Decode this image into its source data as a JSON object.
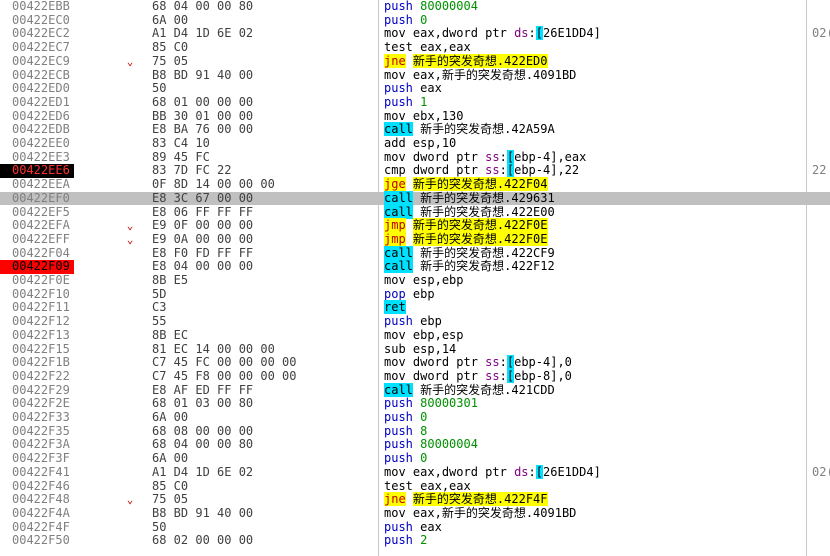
{
  "rows": [
    {
      "addr": "00422EBB",
      "bytes": "68 04 00 00 80",
      "mnem": "push",
      "ops": "80000004"
    },
    {
      "addr": "00422EC0",
      "bytes": "6A 00",
      "mnem": "push",
      "ops": "0"
    },
    {
      "addr": "00422EC2",
      "bytes": "A1 D4 1D 6E 02",
      "mnem": "mov",
      "ops": "eax,dword ptr ds:[26E1DD4]",
      "comment": "02("
    },
    {
      "addr": "00422EC7",
      "bytes": "85 C0",
      "mnem": "test",
      "ops": "eax,eax"
    },
    {
      "addr": "00422EC9",
      "bytes": "75 05",
      "mnem": "jne",
      "ops": "新手的突发奇想.422ED0",
      "arrow": "⌄"
    },
    {
      "addr": "00422ECB",
      "bytes": "B8 BD 91 40 00",
      "mnem": "mov",
      "ops": "eax,新手的突发奇想.4091BD"
    },
    {
      "addr": "00422ED0",
      "bytes": "50",
      "mnem": "push",
      "ops": "eax"
    },
    {
      "addr": "00422ED1",
      "bytes": "68 01 00 00 00",
      "mnem": "push",
      "ops": "1"
    },
    {
      "addr": "00422ED6",
      "bytes": "BB 30 01 00 00",
      "mnem": "mov",
      "ops": "ebx,130"
    },
    {
      "addr": "00422EDB",
      "bytes": "E8 BA 76 00 00",
      "mnem": "call",
      "ops": "新手的突发奇想.42A59A"
    },
    {
      "addr": "00422EE0",
      "bytes": "83 C4 10",
      "mnem": "add",
      "ops": "esp,10"
    },
    {
      "addr": "00422EE3",
      "bytes": "89 45 FC",
      "mnem": "mov",
      "ops": "dword ptr ss:[ebp-4],eax"
    },
    {
      "addr": "00422EE6",
      "bytes": "83 7D FC 22",
      "mnem": "cmp",
      "ops": "dword ptr ss:[ebp-4],22",
      "comment": "22"
    },
    {
      "addr": "00422EEA",
      "bytes": "0F 8D 14 00 00 00",
      "mnem": "jge",
      "ops": "新手的突发奇想.422F04"
    },
    {
      "addr": "00422EF0",
      "bytes": "E8 3C 67 00 00",
      "mnem": "call",
      "ops": "新手的突发奇想.429631"
    },
    {
      "addr": "00422EF5",
      "bytes": "E8 06 FF FF FF",
      "mnem": "call",
      "ops": "新手的突发奇想.422E00"
    },
    {
      "addr": "00422EFA",
      "bytes": "E9 0F 00 00 00",
      "mnem": "jmp",
      "ops": "新手的突发奇想.422F0E",
      "arrow": "⌄"
    },
    {
      "addr": "00422EFF",
      "bytes": "E9 0A 00 00 00",
      "mnem": "jmp",
      "ops": "新手的突发奇想.422F0E",
      "arrow": "⌄"
    },
    {
      "addr": "00422F04",
      "bytes": "E8 F0 FD FF FF",
      "mnem": "call",
      "ops": "新手的突发奇想.422CF9"
    },
    {
      "addr": "00422F09",
      "bytes": "E8 04 00 00 00",
      "mnem": "call",
      "ops": "新手的突发奇想.422F12"
    },
    {
      "addr": "00422F0E",
      "bytes": "8B E5",
      "mnem": "mov",
      "ops": "esp,ebp"
    },
    {
      "addr": "00422F10",
      "bytes": "5D",
      "mnem": "pop",
      "ops": "ebp"
    },
    {
      "addr": "00422F11",
      "bytes": "C3",
      "mnem": "ret",
      "ops": ""
    },
    {
      "addr": "00422F12",
      "bytes": "55",
      "mnem": "push",
      "ops": "ebp"
    },
    {
      "addr": "00422F13",
      "bytes": "8B EC",
      "mnem": "mov",
      "ops": "ebp,esp"
    },
    {
      "addr": "00422F15",
      "bytes": "81 EC 14 00 00 00",
      "mnem": "sub",
      "ops": "esp,14"
    },
    {
      "addr": "00422F1B",
      "bytes": "C7 45 FC 00 00 00 00",
      "mnem": "mov",
      "ops": "dword ptr ss:[ebp-4],0"
    },
    {
      "addr": "00422F22",
      "bytes": "C7 45 F8 00 00 00 00",
      "mnem": "mov",
      "ops": "dword ptr ss:[ebp-8],0"
    },
    {
      "addr": "00422F29",
      "bytes": "E8 AF ED FF FF",
      "mnem": "call",
      "ops": "新手的突发奇想.421CDD"
    },
    {
      "addr": "00422F2E",
      "bytes": "68 01 03 00 80",
      "mnem": "push",
      "ops": "80000301"
    },
    {
      "addr": "00422F33",
      "bytes": "6A 00",
      "mnem": "push",
      "ops": "0"
    },
    {
      "addr": "00422F35",
      "bytes": "68 08 00 00 00",
      "mnem": "push",
      "ops": "8"
    },
    {
      "addr": "00422F3A",
      "bytes": "68 04 00 00 80",
      "mnem": "push",
      "ops": "80000004"
    },
    {
      "addr": "00422F3F",
      "bytes": "6A 00",
      "mnem": "push",
      "ops": "0"
    },
    {
      "addr": "00422F41",
      "bytes": "A1 D4 1D 6E 02",
      "mnem": "mov",
      "ops": "eax,dword ptr ds:[26E1DD4]",
      "comment": "02("
    },
    {
      "addr": "00422F46",
      "bytes": "85 C0",
      "mnem": "test",
      "ops": "eax,eax"
    },
    {
      "addr": "00422F48",
      "bytes": "75 05",
      "mnem": "jne",
      "ops": "新手的突发奇想.422F4F",
      "arrow": "⌄"
    },
    {
      "addr": "00422F4A",
      "bytes": "B8 BD 91 40 00",
      "mnem": "mov",
      "ops": "eax,新手的突发奇想.4091BD"
    },
    {
      "addr": "00422F4F",
      "bytes": "50",
      "mnem": "push",
      "ops": "eax"
    },
    {
      "addr": "00422F50",
      "bytes": "68 02 00 00 00",
      "mnem": "push",
      "ops": "2"
    }
  ],
  "current_addr": "00422EF0",
  "breakpoints": {
    "00422EE6": "black",
    "00422F09": "red"
  },
  "colors": {
    "jump_highlight": "#ffff00",
    "call_highlight": "#00e0ff",
    "current_line": "#c0c0c0",
    "breakpoint_red": "#ff0000",
    "breakpoint_black": "#000000"
  }
}
